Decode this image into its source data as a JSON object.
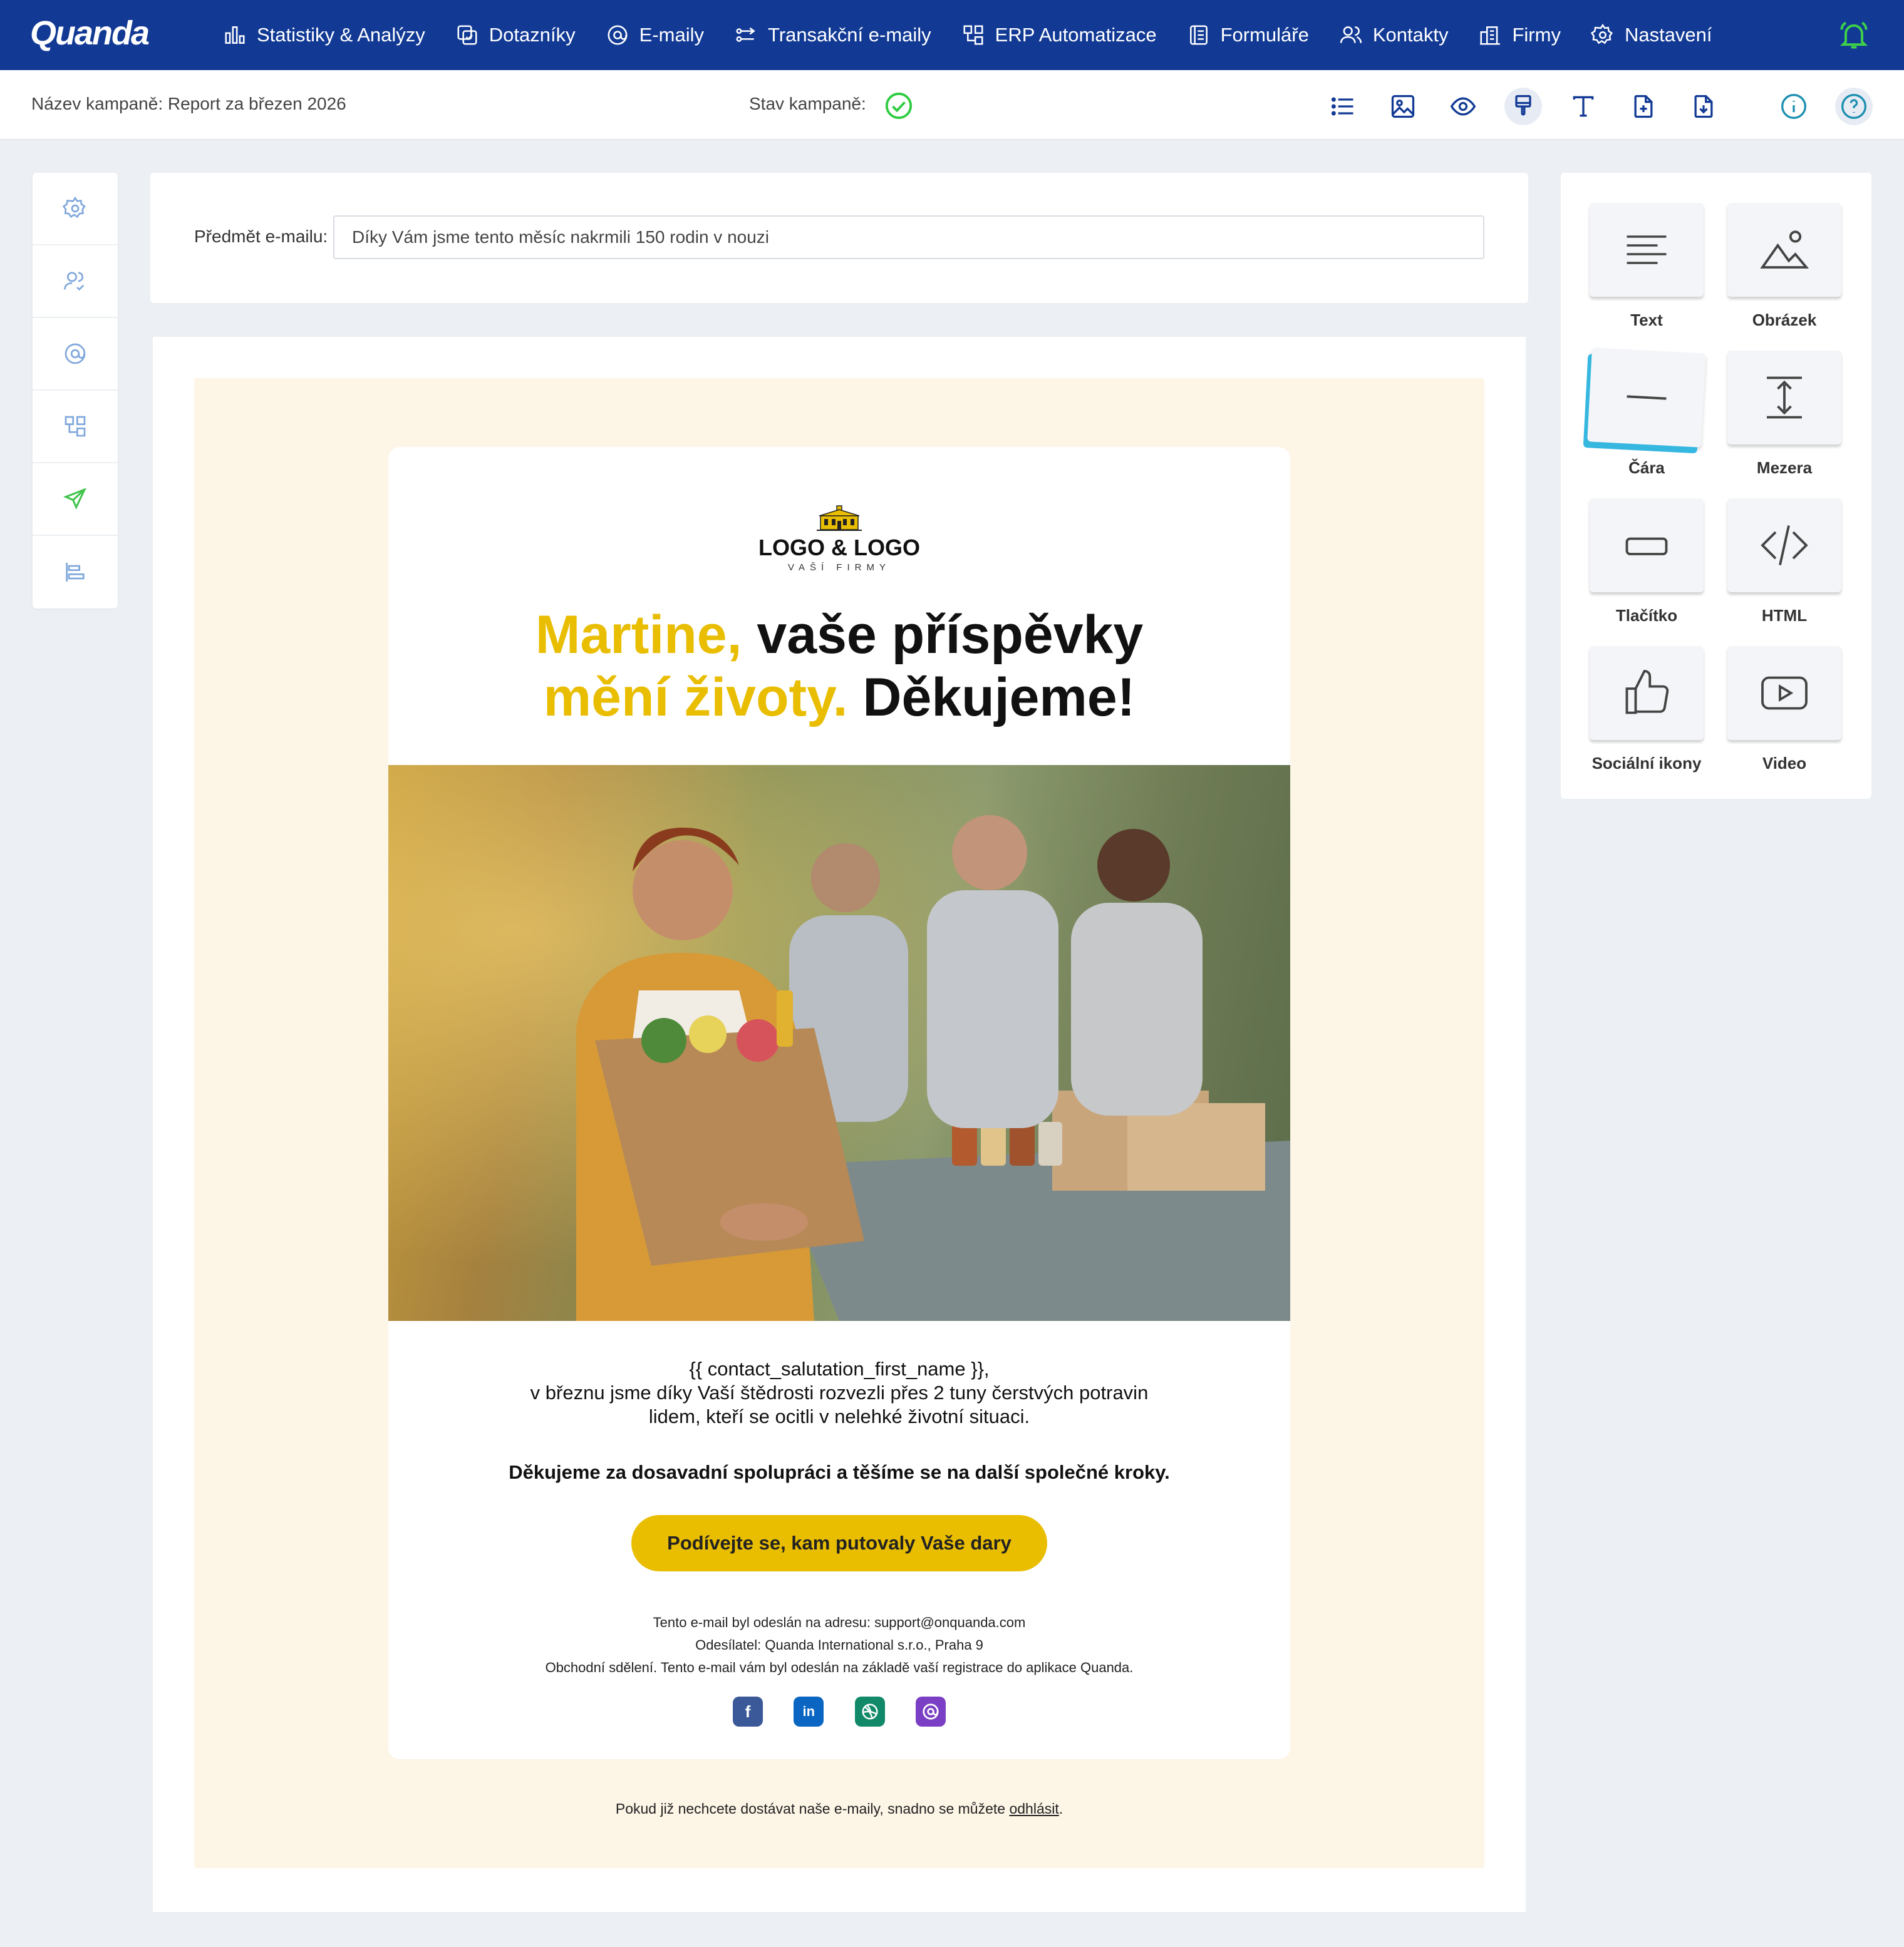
{
  "app": {
    "logo": "Quanda"
  },
  "nav": {
    "items": [
      {
        "label": "Statistiky & Analýzy",
        "icon": "chart-icon"
      },
      {
        "label": "Dotazníky",
        "icon": "survey-icon"
      },
      {
        "label": "E-maily",
        "icon": "at-icon"
      },
      {
        "label": "Transakční e-maily",
        "icon": "transactional-icon"
      },
      {
        "label": "ERP Automatizace",
        "icon": "automation-icon"
      },
      {
        "label": "Formuláře",
        "icon": "form-icon"
      },
      {
        "label": "Kontakty",
        "icon": "contacts-icon"
      },
      {
        "label": "Firmy",
        "icon": "company-icon"
      },
      {
        "label": "Nastavení",
        "icon": "gear-icon"
      }
    ]
  },
  "campaign": {
    "name_label": "Název kampaně: Report za březen 2026",
    "state_label": "Stav kampaně:"
  },
  "subject": {
    "label": "Předmět e-mailu:",
    "value": "Díky Vám jsme tento měsíc nakrmili 150 rodin v nouzi"
  },
  "email": {
    "logo_main": "LOGO & LOGO",
    "logo_sub": "VAŠÍ FIRMY",
    "headline_yellow_1": "Martine,",
    "headline_black_1": " vaše příspěvky",
    "headline_yellow_2": "mění životy.",
    "headline_black_2": " Děkujeme!",
    "body_line_1": "{{ contact_salutation_first_name }},",
    "body_line_2": "v březnu jsme díky Vaší štědrosti rozvezli přes 2 tuny čerstvých potravin",
    "body_line_3": "lidem, kteří se ocitli v nelehké životní situaci.",
    "body_bold": "Děkujeme za dosavadní spolupráci a těšíme se na další společné kroky.",
    "cta_label": "Podívejte se, kam putovaly Vaše dary",
    "footer_1": "Tento e-mail byl odeslán na adresu: support@onquanda.com",
    "footer_2": "Odesílatel: Quanda International s.r.o., Praha 9",
    "footer_3": "Obchodní sdělení. Tento e-mail vám byl odeslán na základě vaší registrace do aplikace Quanda.",
    "unsub_text": "Pokud již nechcete dostávat naše e-maily, snadno se můžete ",
    "unsub_link": "odhlásit",
    "unsub_end": "."
  },
  "blocks": [
    {
      "label": "Text",
      "icon": "text-icon"
    },
    {
      "label": "Obrázek",
      "icon": "image-icon"
    },
    {
      "label": "Čára",
      "icon": "line-icon"
    },
    {
      "label": "Mezera",
      "icon": "spacer-icon"
    },
    {
      "label": "Tlačítko",
      "icon": "button-icon"
    },
    {
      "label": "HTML",
      "icon": "code-icon"
    },
    {
      "label": "Sociální ikony",
      "icon": "thumbs-up-icon"
    },
    {
      "label": "Video",
      "icon": "video-icon"
    }
  ],
  "colors": {
    "nav_bg": "#123a95",
    "accent_yellow": "#e9bd00",
    "success_green": "#2ecc40",
    "email_bg": "#fdf5e6",
    "facebook": "#3b5998",
    "linkedin": "#0a66c2",
    "dribbble": "#128a6a",
    "email_social": "#7a3fc4"
  }
}
